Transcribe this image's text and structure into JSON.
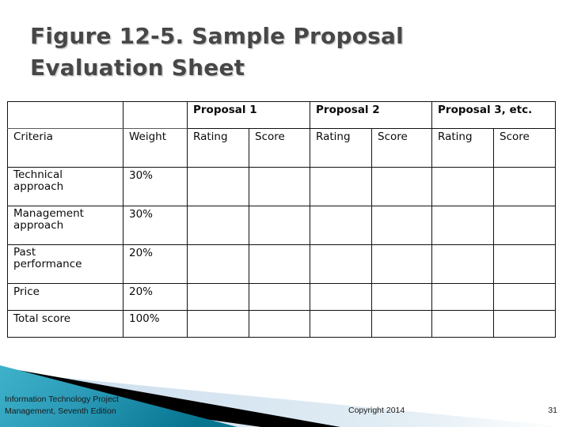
{
  "slide": {
    "title": "Figure 12-5. Sample Proposal\nEvaluation Sheet",
    "title_color": "#474747",
    "background": "#ffffff"
  },
  "table": {
    "group_headers": {
      "criteria_blank": "",
      "weight_blank": "",
      "proposal_1": "Proposal 1",
      "proposal_2": "Proposal 2",
      "proposal_3": "Proposal 3, etc."
    },
    "column_headers": {
      "criteria": "Criteria",
      "weight": "Weight",
      "rating_1": "Rating",
      "score_1": "Score",
      "rating_2": "Rating",
      "score_2": "Score",
      "rating_3": "Rating",
      "score_3": "Score"
    },
    "rows": [
      {
        "criteria": "Technical\napproach",
        "weight": "30%",
        "rating_1": "",
        "score_1": "",
        "rating_2": "",
        "score_2": "",
        "rating_3": "",
        "score_3": "",
        "bold": false
      },
      {
        "criteria": "Management\napproach",
        "weight": "30%",
        "rating_1": "",
        "score_1": "",
        "rating_2": "",
        "score_2": "",
        "rating_3": "",
        "score_3": "",
        "bold": false
      },
      {
        "criteria": "Past\nperformance",
        "weight": "20%",
        "rating_1": "",
        "score_1": "",
        "rating_2": "",
        "score_2": "",
        "rating_3": "",
        "score_3": "",
        "bold": false
      },
      {
        "criteria": "Price",
        "weight": "20%",
        "rating_1": "",
        "score_1": "",
        "rating_2": "",
        "score_2": "",
        "rating_3": "",
        "score_3": "",
        "bold": false
      },
      {
        "criteria": "Total score",
        "weight": "100%",
        "rating_1": "",
        "score_1": "",
        "rating_2": "",
        "score_2": "",
        "rating_3": "",
        "score_3": "",
        "bold": true
      }
    ],
    "border_color": "#111111"
  },
  "footer": {
    "book_title": "Information Technology Project\nManagement, Seventh Edition",
    "copyright": "Copyright 2014",
    "page_number": "31",
    "accent_teal_light": "#38a7c0",
    "accent_teal_dark": "#0b7f9c",
    "accent_black": "#000000",
    "accent_pale_blue": "#d7e6ef"
  }
}
